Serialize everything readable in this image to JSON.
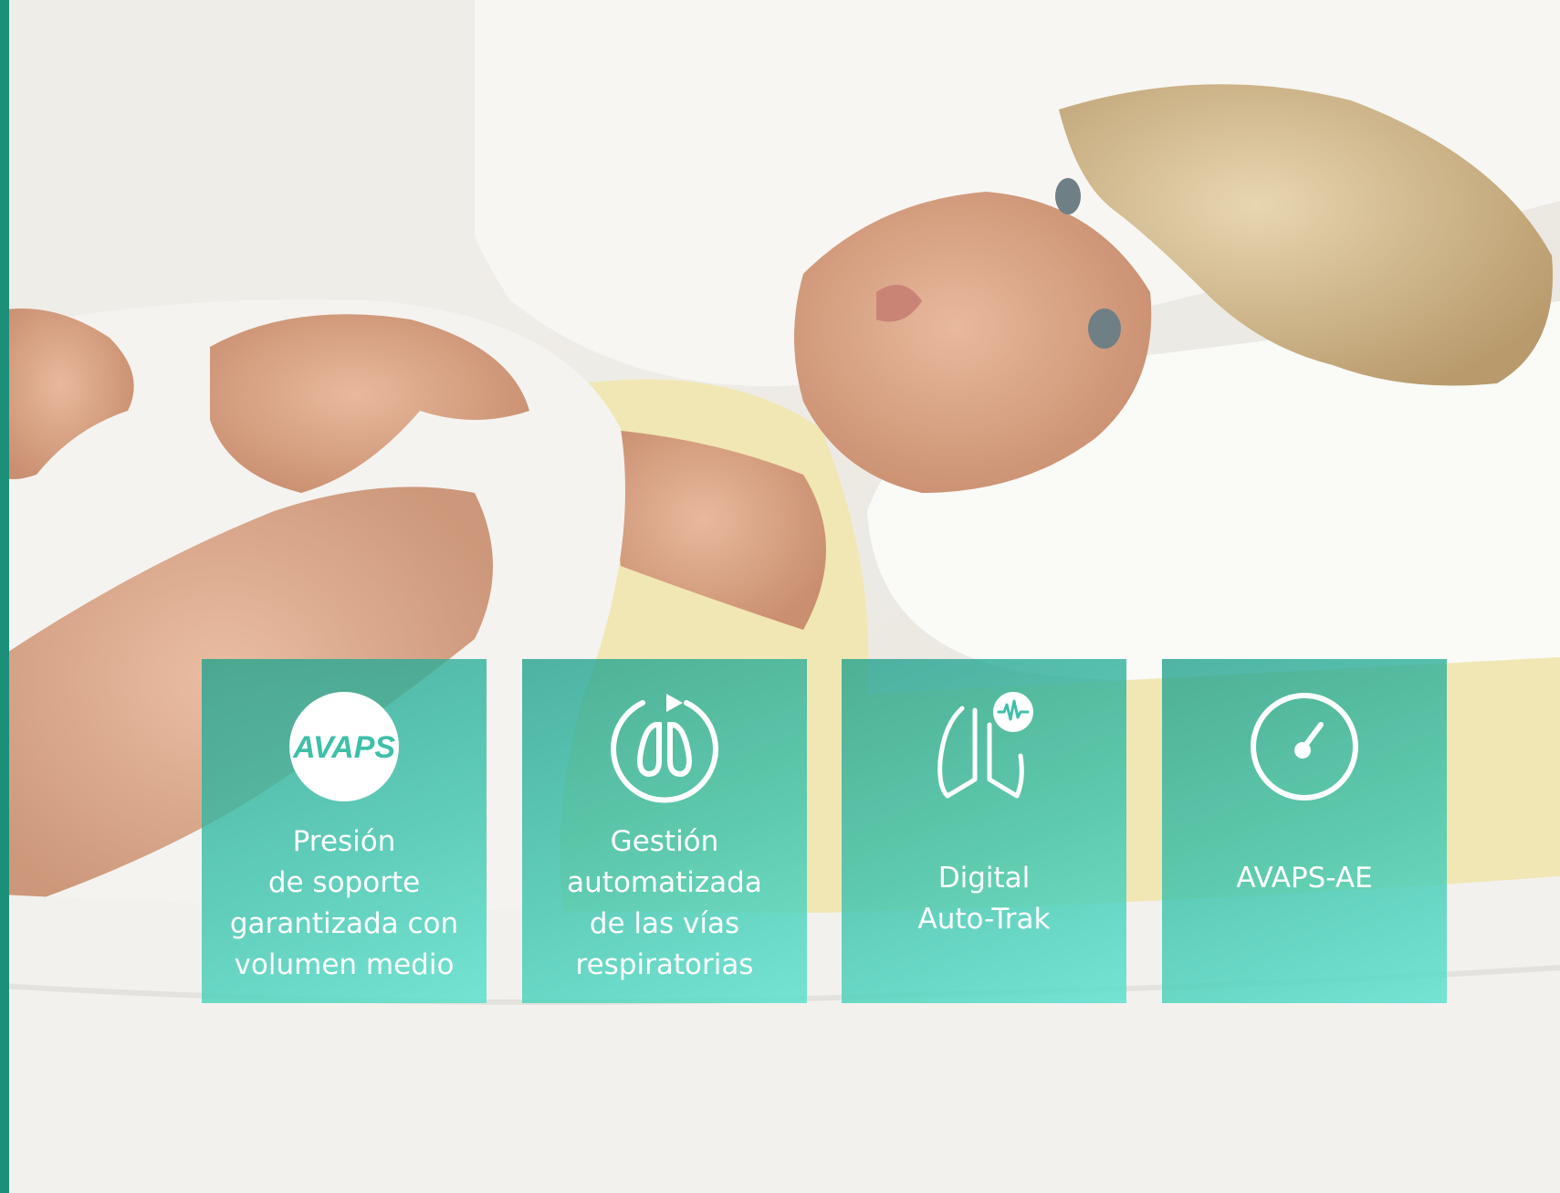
{
  "page": {
    "accent_color": "#1c8f79",
    "tile_color": "#3fbfa8"
  },
  "hero_image": {
    "icon": "woman-resting-in-bed-photo"
  },
  "features": [
    {
      "icon": "avaps-logo-icon",
      "logo_text": "AVAPS",
      "label": "Presión\nde soporte\ngarantizada con\nvolumen medio"
    },
    {
      "icon": "lungs-cycle-icon",
      "label": "Gestión\nautomatizada\nde las vías\nrespiratorias"
    },
    {
      "icon": "lungs-waveform-icon",
      "label": "Digital\nAuto-Trak"
    },
    {
      "icon": "gauge-icon",
      "label": "AVAPS-AE"
    }
  ]
}
